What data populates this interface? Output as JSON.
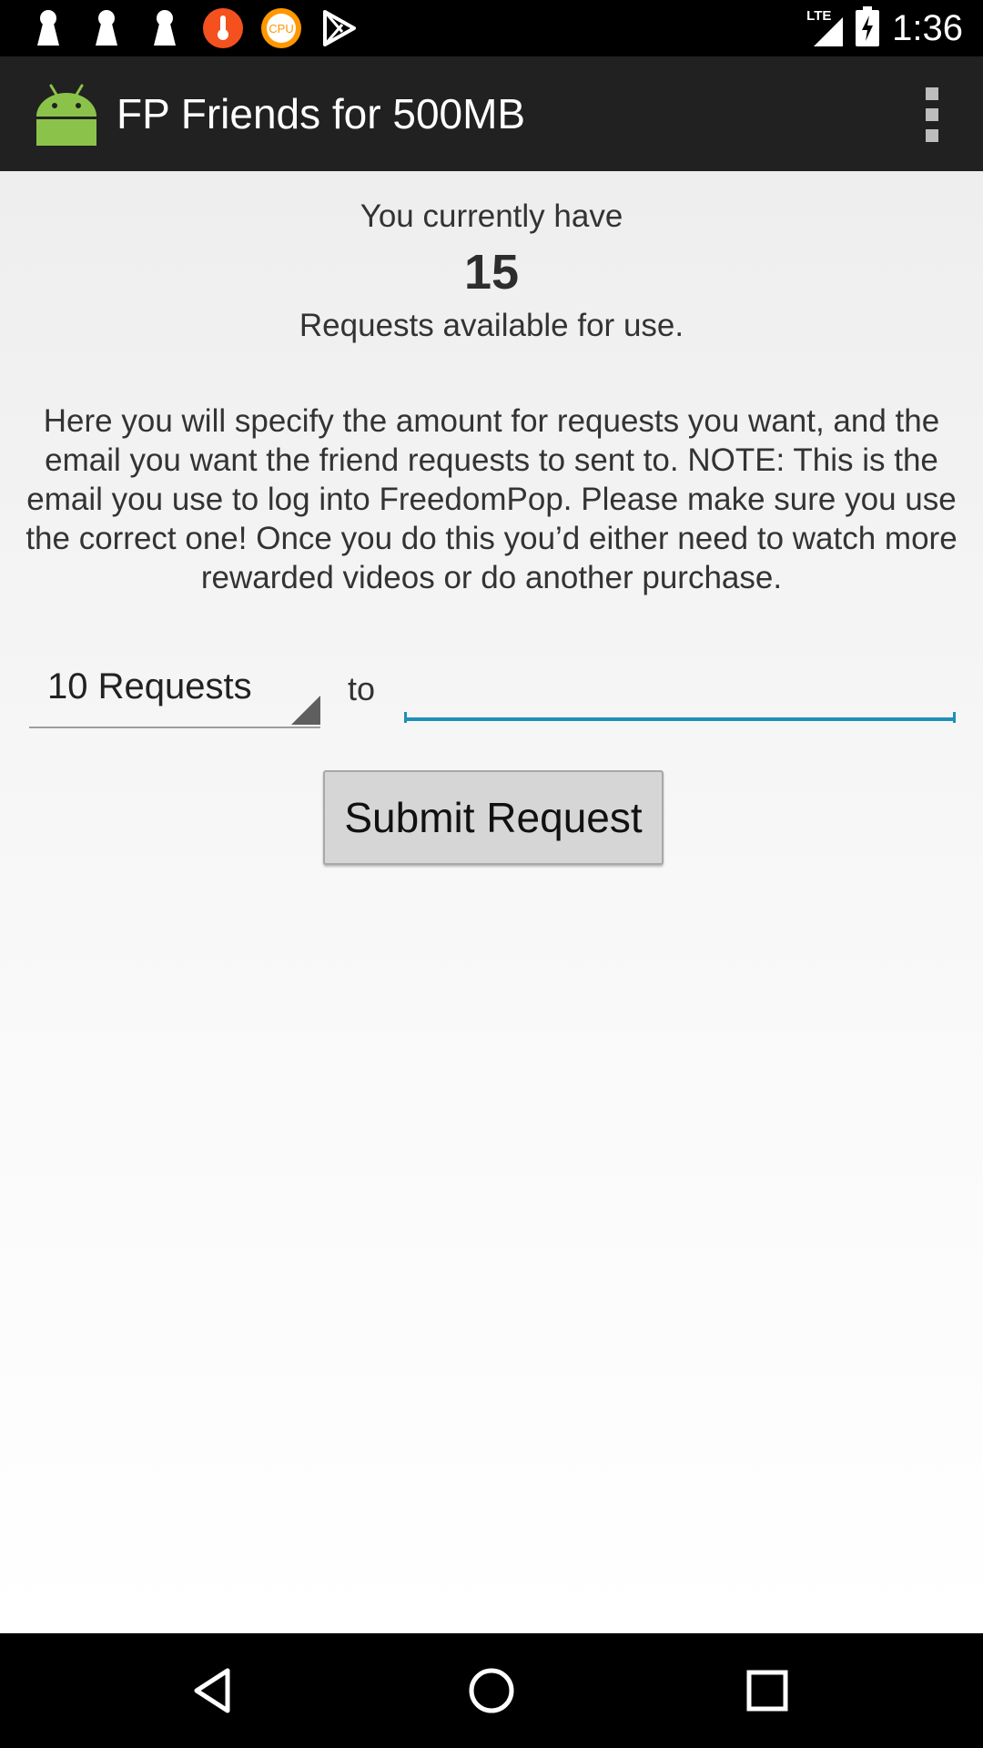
{
  "status_bar": {
    "time": "1:36",
    "network": "LTE",
    "icons": [
      "keyhole-icon",
      "keyhole-icon",
      "keyhole-icon",
      "thermometer-icon",
      "cpu-icon",
      "play-store-icon",
      "signal-icon",
      "battery-charging-icon"
    ],
    "cpu_label": "CPU"
  },
  "action_bar": {
    "title": "FP Friends for 500MB",
    "app_icon": "android-icon",
    "menu_icon": "overflow-menu-icon"
  },
  "main": {
    "line1": "You currently have",
    "count": "15",
    "line3": "Requests available for use.",
    "description": "Here you will specify the amount for requests you want, and the email you want the friend requests to sent to.  NOTE: This is the email you use to log into FreedomPop.  Please make sure you use the correct one!  Once you do this you’d either need to watch more rewarded videos or do another purchase.",
    "spinner_value": "10 Requests",
    "to_label": "to",
    "email_value": "",
    "email_placeholder": "",
    "submit_label": "Submit Request"
  },
  "nav_bar": {
    "buttons": [
      "back-icon",
      "home-icon",
      "recents-icon"
    ]
  },
  "colors": {
    "accent": "#1e90b8",
    "action_bar": "#212121",
    "android_green": "#8bc34a",
    "thermo_red": "#f4511e",
    "cpu_orange": "#ff9800"
  }
}
